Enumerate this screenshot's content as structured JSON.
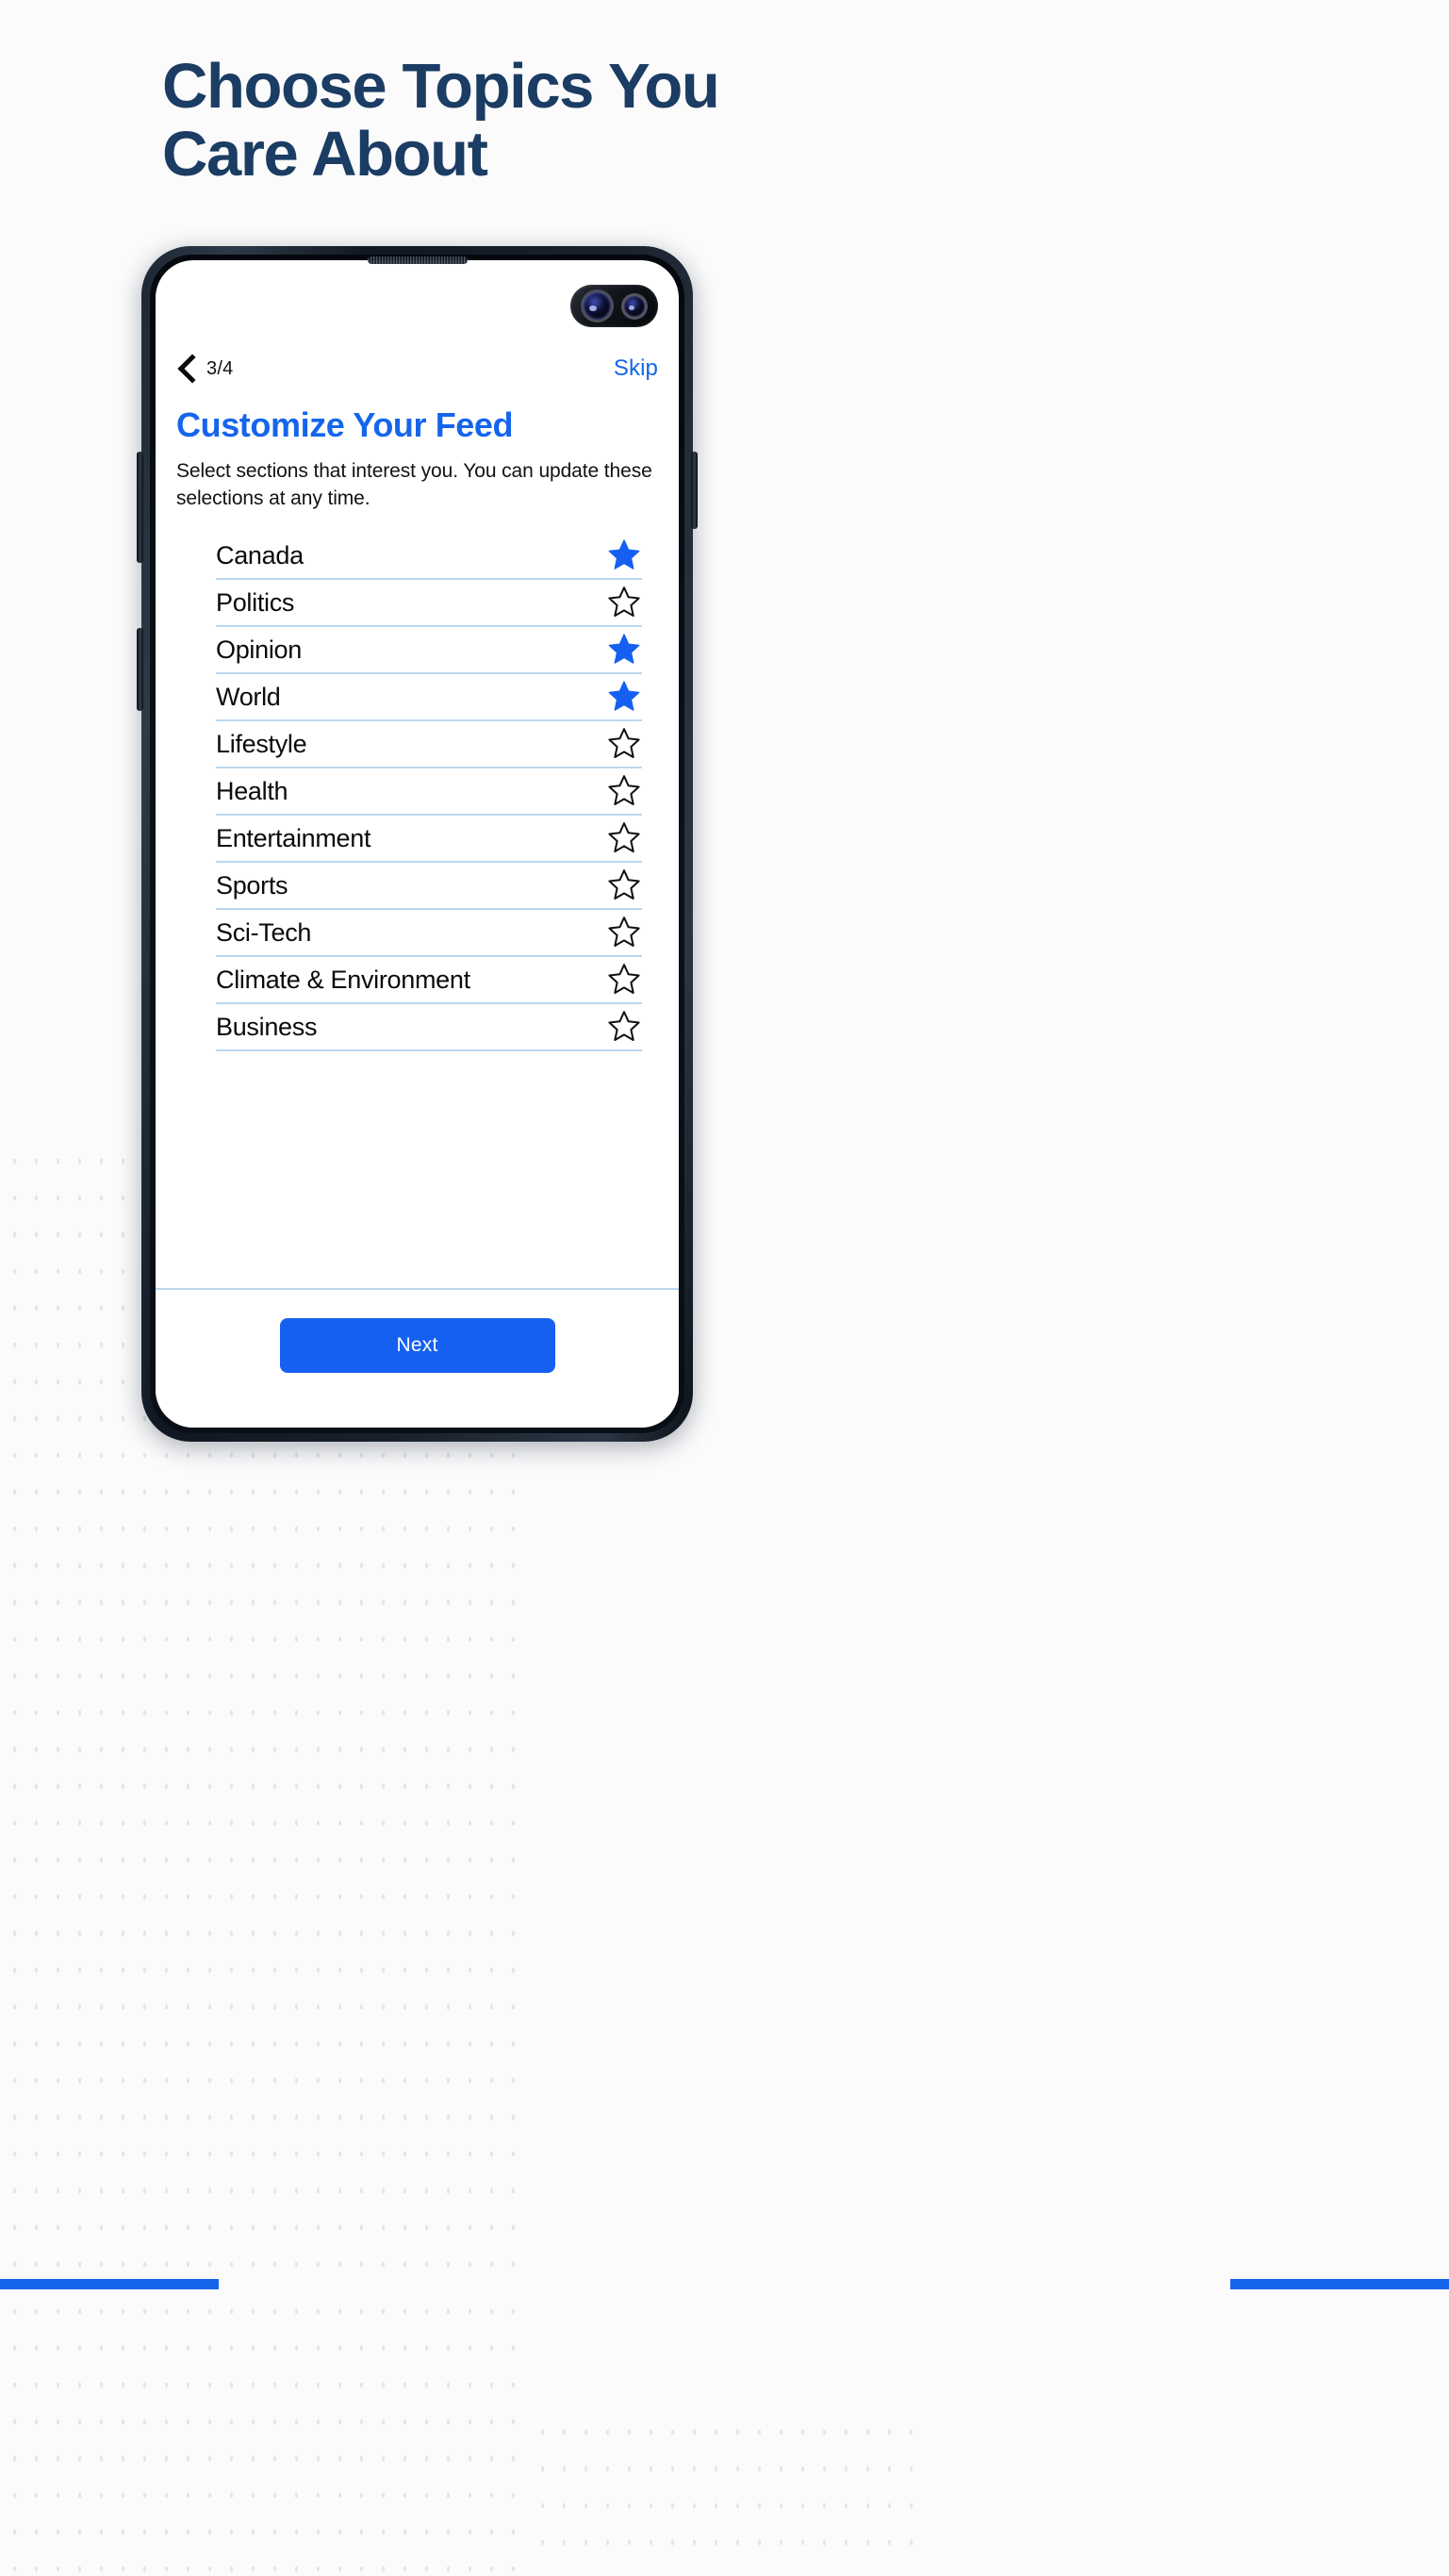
{
  "headline": {
    "line1": "Choose Topics You",
    "line2": "Care About",
    "color": "#1b3c63"
  },
  "phone_screen": {
    "topbar": {
      "back_icon": "chevron-left-icon",
      "step": "3/4",
      "skip_label": "Skip",
      "skip_color": "#1565ec"
    },
    "title": "Customize Your Feed",
    "title_color": "#1565ec",
    "subtitle": "Select sections that interest you. You can update these selections at any time.",
    "topics": [
      {
        "label": "Canada",
        "selected": true
      },
      {
        "label": "Politics",
        "selected": false
      },
      {
        "label": "Opinion",
        "selected": true
      },
      {
        "label": "World",
        "selected": true
      },
      {
        "label": "Lifestyle",
        "selected": false
      },
      {
        "label": "Health",
        "selected": false
      },
      {
        "label": "Entertainment",
        "selected": false
      },
      {
        "label": "Sports",
        "selected": false
      },
      {
        "label": "Sci-Tech",
        "selected": false
      },
      {
        "label": "Climate & Environment",
        "selected": false
      },
      {
        "label": "Business",
        "selected": false
      }
    ],
    "star_filled_color": "#1560f0",
    "star_empty_color": "#111111",
    "divider_color": "#bcd7ef",
    "next_label": "Next",
    "next_color": "#1560f0"
  },
  "decor": {
    "dot_color": "#e2e6ea",
    "rule_color": "#1565ec",
    "background": "#fbfbfc"
  }
}
